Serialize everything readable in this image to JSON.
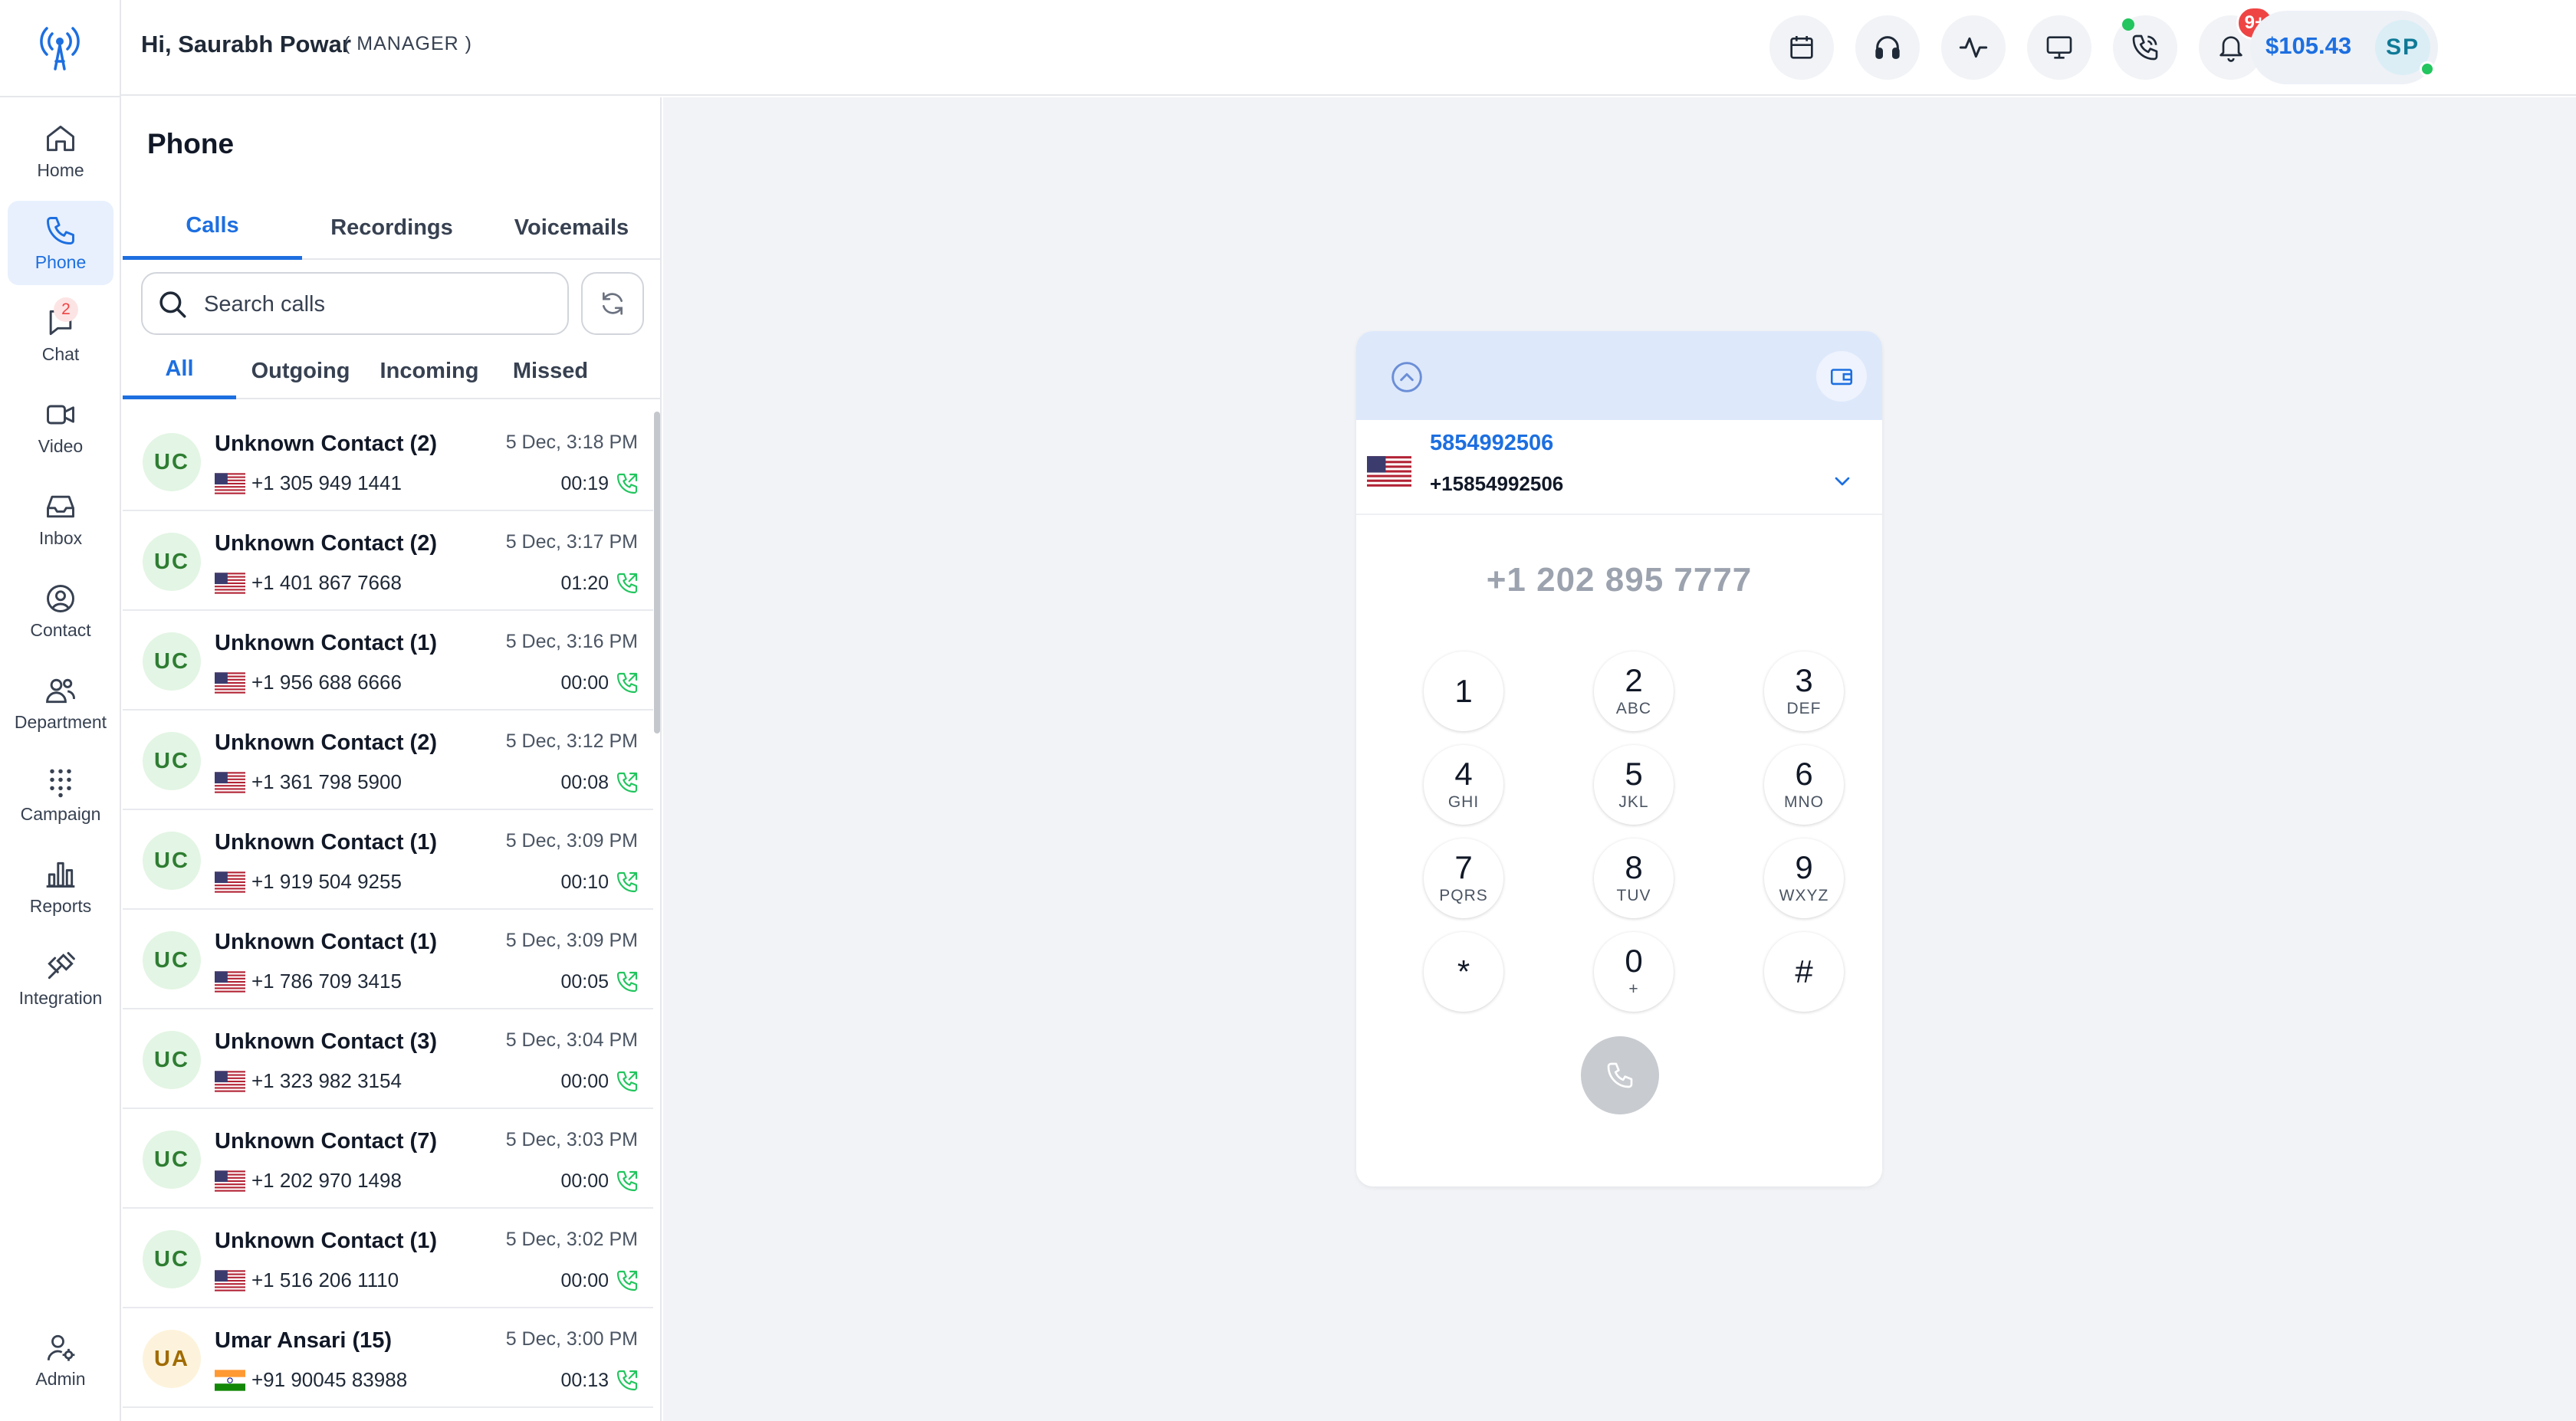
{
  "header": {
    "greeting": "Hi, Saurabh Powar",
    "role": "( MANAGER )",
    "notifications_badge": "9+",
    "balance": "$105.43",
    "avatar_initials": "SP"
  },
  "nav": {
    "items": [
      {
        "label": "Home",
        "icon": "home-icon"
      },
      {
        "label": "Phone",
        "icon": "phone-icon"
      },
      {
        "label": "Chat",
        "icon": "chat-icon",
        "badge": "2"
      },
      {
        "label": "Video",
        "icon": "video-icon"
      },
      {
        "label": "Inbox",
        "icon": "inbox-icon"
      },
      {
        "label": "Contact",
        "icon": "contact-icon"
      },
      {
        "label": "Department",
        "icon": "department-icon"
      },
      {
        "label": "Campaign",
        "icon": "campaign-icon"
      },
      {
        "label": "Reports",
        "icon": "reports-icon"
      },
      {
        "label": "Integration",
        "icon": "integration-icon"
      }
    ],
    "admin_label": "Admin",
    "active": "Phone"
  },
  "phone_panel": {
    "title": "Phone",
    "tabs": [
      "Calls",
      "Recordings",
      "Voicemails"
    ],
    "active_tab": "Calls",
    "search_placeholder": "Search calls",
    "filters": [
      "All",
      "Outgoing",
      "Incoming",
      "Missed"
    ],
    "active_filter": "All",
    "calls": [
      {
        "initials": "UC",
        "name": "Unknown Contact (2)",
        "number": "+1 305 949 1441",
        "date": "5 Dec, 3:18 PM",
        "duration": "00:19",
        "country": "us"
      },
      {
        "initials": "UC",
        "name": "Unknown Contact (2)",
        "number": "+1 401 867 7668",
        "date": "5 Dec, 3:17 PM",
        "duration": "01:20",
        "country": "us"
      },
      {
        "initials": "UC",
        "name": "Unknown Contact (1)",
        "number": "+1 956 688 6666",
        "date": "5 Dec, 3:16 PM",
        "duration": "00:00",
        "country": "us"
      },
      {
        "initials": "UC",
        "name": "Unknown Contact (2)",
        "number": "+1 361 798 5900",
        "date": "5 Dec, 3:12 PM",
        "duration": "00:08",
        "country": "us"
      },
      {
        "initials": "UC",
        "name": "Unknown Contact (1)",
        "number": "+1 919 504 9255",
        "date": "5 Dec, 3:09 PM",
        "duration": "00:10",
        "country": "us"
      },
      {
        "initials": "UC",
        "name": "Unknown Contact (1)",
        "number": "+1 786 709 3415",
        "date": "5 Dec, 3:09 PM",
        "duration": "00:05",
        "country": "us"
      },
      {
        "initials": "UC",
        "name": "Unknown Contact (3)",
        "number": "+1 323 982 3154",
        "date": "5 Dec, 3:04 PM",
        "duration": "00:00",
        "country": "us"
      },
      {
        "initials": "UC",
        "name": "Unknown Contact (7)",
        "number": "+1 202 970 1498",
        "date": "5 Dec, 3:03 PM",
        "duration": "00:00",
        "country": "us"
      },
      {
        "initials": "UC",
        "name": "Unknown Contact (1)",
        "number": "+1 516 206 1110",
        "date": "5 Dec, 3:02 PM",
        "duration": "00:00",
        "country": "us"
      },
      {
        "initials": "UA",
        "name": "Umar Ansari (15)",
        "number": "+91 90045 83988",
        "date": "5 Dec, 3:00 PM",
        "duration": "00:13",
        "country": "in"
      }
    ]
  },
  "dialer": {
    "caller_name": "5854992506",
    "caller_number": "+15854992506",
    "display_number": "+1 202 895 7777",
    "keys": [
      {
        "digit": "1",
        "letters": ""
      },
      {
        "digit": "2",
        "letters": "ABC"
      },
      {
        "digit": "3",
        "letters": "DEF"
      },
      {
        "digit": "4",
        "letters": "GHI"
      },
      {
        "digit": "5",
        "letters": "JKL"
      },
      {
        "digit": "6",
        "letters": "MNO"
      },
      {
        "digit": "7",
        "letters": "PQRS"
      },
      {
        "digit": "8",
        "letters": "TUV"
      },
      {
        "digit": "9",
        "letters": "WXYZ"
      },
      {
        "digit": "*",
        "letters": ""
      },
      {
        "digit": "0",
        "letters": "+"
      },
      {
        "digit": "#",
        "letters": ""
      }
    ]
  },
  "colors": {
    "accent": "#1d6fe0",
    "online": "#22c55e",
    "alert": "#ef4444"
  }
}
